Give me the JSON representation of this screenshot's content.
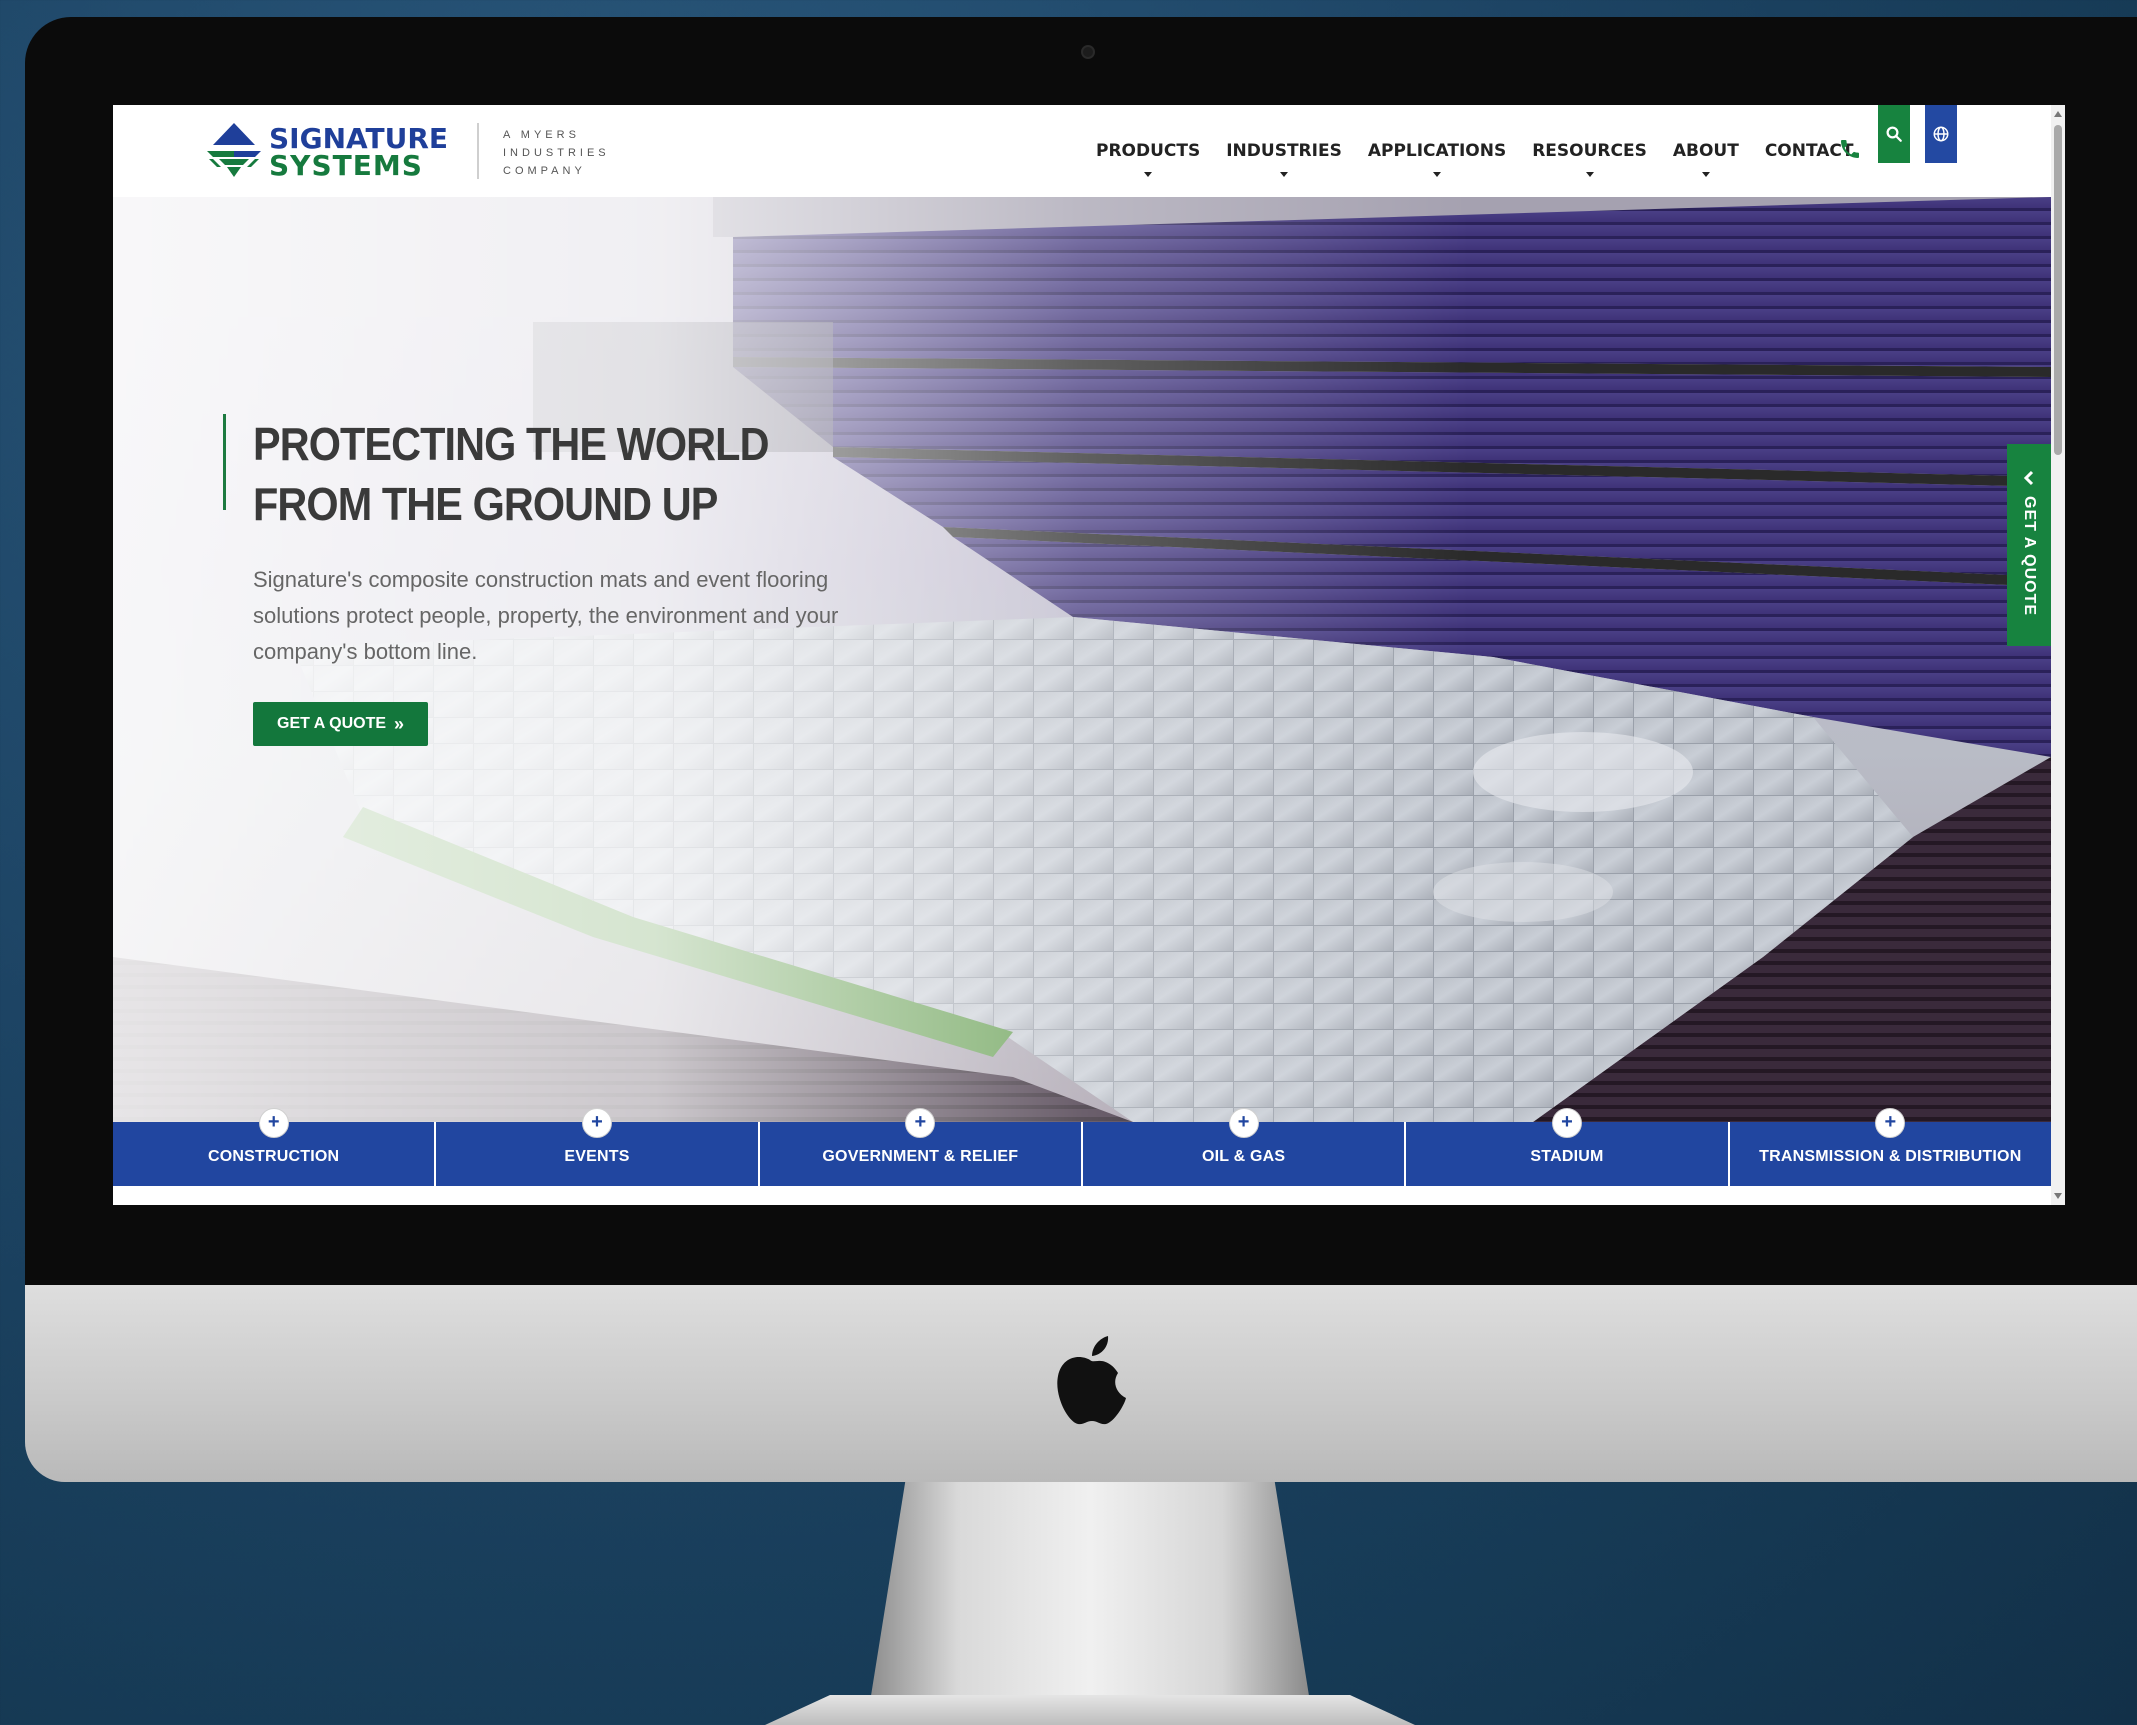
{
  "header": {
    "logo": {
      "name_line1": "SIGNATURE",
      "name_line2": "SYSTEMS",
      "tagline": "A MYERS INDUSTRIES COMPANY"
    },
    "nav": [
      {
        "label": "PRODUCTS",
        "has_dropdown": true
      },
      {
        "label": "INDUSTRIES",
        "has_dropdown": true
      },
      {
        "label": "APPLICATIONS",
        "has_dropdown": true
      },
      {
        "label": "RESOURCES",
        "has_dropdown": true
      },
      {
        "label": "ABOUT",
        "has_dropdown": true
      },
      {
        "label": "CONTACT",
        "has_dropdown": false
      }
    ],
    "icons": {
      "phone": "phone-icon",
      "search": "search-icon",
      "language": "globe-icon"
    }
  },
  "hero": {
    "title": "PROTECTING THE WORLD FROM THE GROUND UP",
    "text": "Signature's composite construction mats and event flooring solutions protect people, property, the environment and your company's bottom line.",
    "cta_label": "GET A QUOTE",
    "cta_icon": "double-chevron-right-icon"
  },
  "side_tab": {
    "label": "GET A QUOTE",
    "icon": "chevron-left-icon"
  },
  "industries": [
    {
      "label": "CONSTRUCTION"
    },
    {
      "label": "EVENTS"
    },
    {
      "label": "GOVERNMENT & RELIEF"
    },
    {
      "label": "OIL & GAS"
    },
    {
      "label": "STADIUM"
    },
    {
      "label": "TRANSMISSION & DISTRIBUTION"
    }
  ],
  "colors": {
    "brand_blue": "#2146a0",
    "brand_green": "#13773c",
    "text_dark": "#3a3a3a",
    "text_body": "#666666"
  }
}
